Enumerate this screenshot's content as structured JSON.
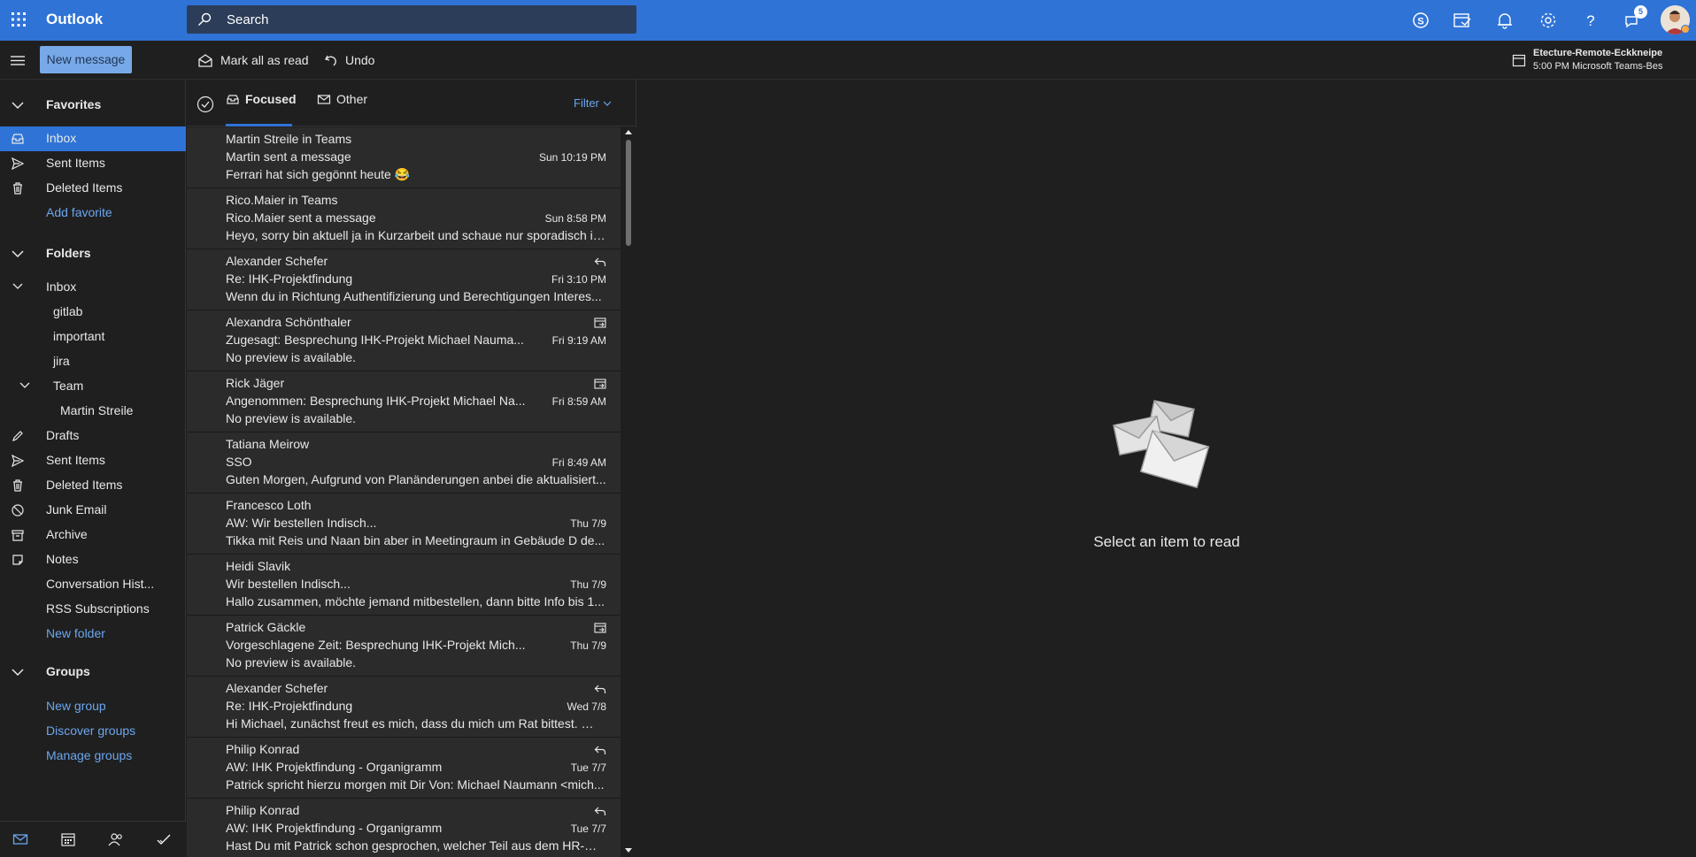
{
  "header": {
    "app_title": "Outlook",
    "search_placeholder": "Search",
    "notification_count": "5",
    "icons": [
      "app-launcher-icon",
      "search-icon",
      "skype-icon",
      "my-day-icon",
      "bell-icon",
      "gear-icon",
      "help-icon",
      "feedback-icon",
      "avatar"
    ],
    "accent": "#2f73d6"
  },
  "command_bar": {
    "new_message": "New message",
    "mark_all_read": "Mark all as read",
    "undo": "Undo",
    "reminder_title": "Etecture-Remote-Eckkneipe",
    "reminder_time": "5:00 PM Microsoft Teams-Bes"
  },
  "nav": {
    "favorites": {
      "label": "Favorites",
      "items": [
        {
          "label": "Inbox",
          "icon": "inbox-icon",
          "selected": true
        },
        {
          "label": "Sent Items",
          "icon": "send-icon"
        },
        {
          "label": "Deleted Items",
          "icon": "trash-icon"
        }
      ],
      "add_favorite": "Add favorite"
    },
    "folders": {
      "label": "Folders",
      "inbox": "Inbox",
      "inbox_children": [
        "gitlab",
        "important",
        "jira"
      ],
      "team": "Team",
      "team_children": [
        "Martin Streile"
      ],
      "items": [
        {
          "label": "Drafts",
          "icon": "pencil-icon"
        },
        {
          "label": "Sent Items",
          "icon": "send-icon"
        },
        {
          "label": "Deleted Items",
          "icon": "trash-icon"
        },
        {
          "label": "Junk Email",
          "icon": "blocked-icon"
        },
        {
          "label": "Archive",
          "icon": "archive-icon"
        },
        {
          "label": "Notes",
          "icon": "note-icon"
        },
        {
          "label": "Conversation Hist...",
          "icon": ""
        },
        {
          "label": "RSS Subscriptions",
          "icon": ""
        }
      ],
      "new_folder": "New folder"
    },
    "groups": {
      "label": "Groups",
      "links": [
        "New group",
        "Discover groups",
        "Manage groups"
      ]
    },
    "bottom_icons": [
      "mail-icon",
      "calendar-icon",
      "people-icon",
      "todo-icon"
    ]
  },
  "list": {
    "tabs": {
      "focused": "Focused",
      "other": "Other"
    },
    "filter": "Filter",
    "messages": [
      {
        "sender": "Martin Streile in Teams",
        "subject": "Martin sent a message",
        "date": "Sun 10:19 PM",
        "preview": "Ferrari hat sich gegönnt heute 😂",
        "icon": ""
      },
      {
        "sender": "Rico.Maier in Teams",
        "subject": "Rico.Maier sent a message",
        "date": "Sun 8:58 PM",
        "preview": "Heyo, sorry bin aktuell ja in Kurzarbeit und schaue nur sporadisch in...",
        "icon": ""
      },
      {
        "sender": "Alexander Schefer",
        "subject": "Re: IHK-Projektfindung",
        "date": "Fri 3:10 PM",
        "preview": "Wenn du in Richtung Authentifizierung und Berechtigungen Interes...",
        "icon": "reply"
      },
      {
        "sender": "Alexandra Schönthaler",
        "subject": "Zugesagt: Besprechung IHK-Projekt Michael Nauma...",
        "date": "Fri 9:19 AM",
        "preview": "No preview is available.",
        "icon": "calendar"
      },
      {
        "sender": "Rick Jäger",
        "subject": "Angenommen: Besprechung IHK-Projekt Michael Na...",
        "date": "Fri 8:59 AM",
        "preview": "No preview is available.",
        "icon": "calendar"
      },
      {
        "sender": "Tatiana Meirow",
        "subject": "SSO",
        "date": "Fri 8:49 AM",
        "preview": "Guten Morgen, Aufgrund von Planänderungen anbei die aktualisiert...",
        "icon": ""
      },
      {
        "sender": "Francesco Loth",
        "subject": "AW: Wir bestellen Indisch...",
        "date": "Thu 7/9",
        "preview": "Tikka mit Reis und Naan bin aber in Meetingraum in Gebäude D de...",
        "icon": ""
      },
      {
        "sender": "Heidi Slavik",
        "subject": "Wir bestellen Indisch...",
        "date": "Thu 7/9",
        "preview": "Hallo zusammen, möchte jemand mitbestellen, dann bitte Info bis 1...",
        "icon": ""
      },
      {
        "sender": "Patrick Gäckle",
        "subject": "Vorgeschlagene Zeit: Besprechung IHK-Projekt Mich...",
        "date": "Thu 7/9",
        "preview": "No preview is available.",
        "icon": "calendar"
      },
      {
        "sender": "Alexander Schefer",
        "subject": "Re: IHK-Projektfindung",
        "date": "Wed 7/8",
        "preview": "Hi Michael, zunächst freut es mich, dass du mich um Rat bittest. 😉 ...",
        "icon": "reply"
      },
      {
        "sender": "Philip Konrad",
        "subject": "AW: IHK Projektfindung - Organigramm",
        "date": "Tue 7/7",
        "preview": "Patrick spricht hierzu morgen mit Dir Von: Michael Naumann <mich...",
        "icon": "reply"
      },
      {
        "sender": "Philip Konrad",
        "subject": "AW: IHK Projektfindung - Organigramm",
        "date": "Tue 7/7",
        "preview": "Hast Du mit Patrick schon gesprochen, welcher Teil aus dem HR-We...",
        "icon": "reply"
      }
    ]
  },
  "reading_pane": {
    "empty_text": "Select an item to read",
    "illustration": "envelopes-icon"
  }
}
